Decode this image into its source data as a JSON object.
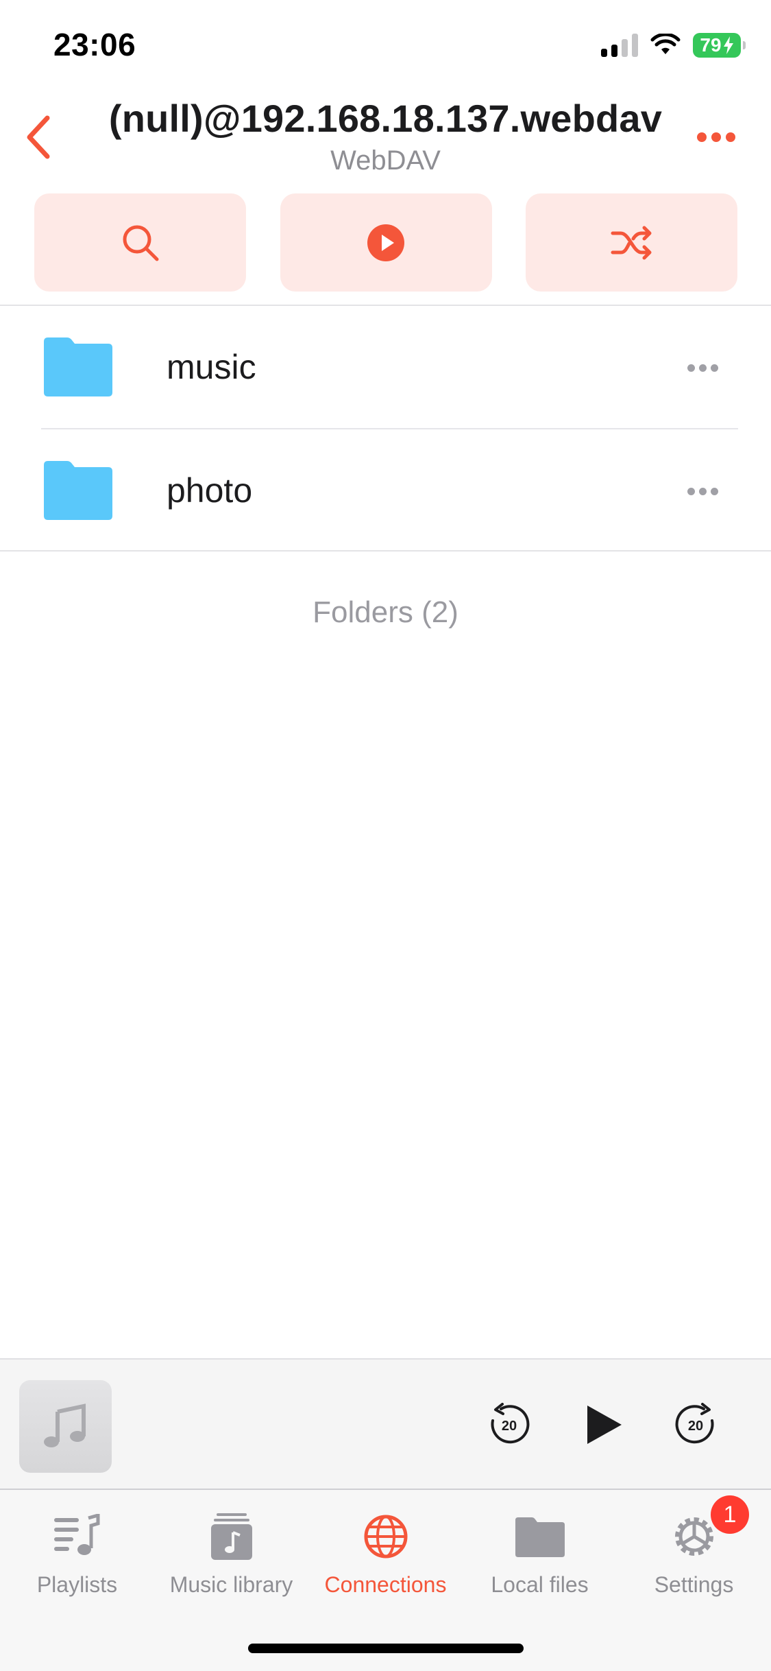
{
  "status_bar": {
    "time": "23:06",
    "battery": "79"
  },
  "header": {
    "title": "(null)@192.168.18.137.webdav",
    "subtitle": "WebDAV",
    "accent_color": "#f4563a"
  },
  "actions": [
    {
      "icon": "search-icon"
    },
    {
      "icon": "play-circle-icon"
    },
    {
      "icon": "shuffle-icon"
    }
  ],
  "list": {
    "items": [
      {
        "name": "music",
        "icon": "folder-icon"
      },
      {
        "name": "photo",
        "icon": "folder-icon"
      }
    ],
    "footer": "Folders (2)"
  },
  "player": {
    "rewind_label": "20",
    "forward_label": "20"
  },
  "tabbar": {
    "tabs": [
      {
        "label": "Playlists",
        "icon": "playlists-icon"
      },
      {
        "label": "Music library",
        "icon": "music-library-icon"
      },
      {
        "label": "Connections",
        "icon": "globe-icon",
        "active": true
      },
      {
        "label": "Local files",
        "icon": "folder-icon"
      },
      {
        "label": "Settings",
        "icon": "gear-icon",
        "badge": "1"
      }
    ]
  }
}
